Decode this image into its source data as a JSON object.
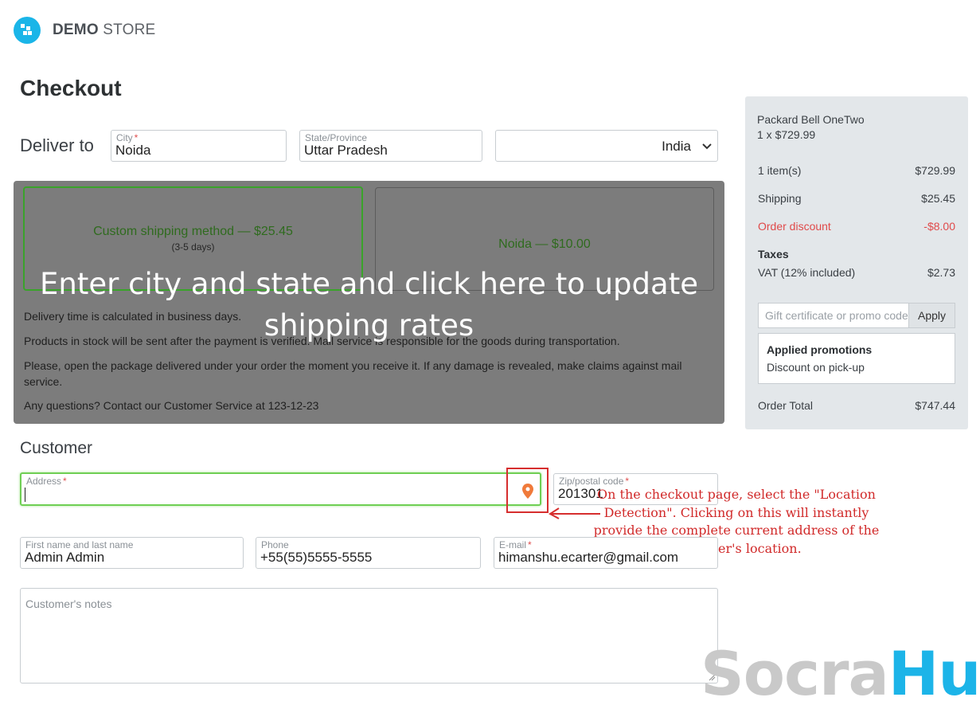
{
  "header": {
    "logo_bold": "DEMO",
    "logo_light": "STORE",
    "logo_icon": "store-logo-icon"
  },
  "page": {
    "title": "Checkout"
  },
  "delivery": {
    "label": "Deliver to",
    "city": {
      "label": "City",
      "required_mark": "*",
      "value": "Noida"
    },
    "state": {
      "label": "State/Province",
      "value": "Uttar Pradesh"
    },
    "country": {
      "value": "India"
    }
  },
  "shipping": {
    "methods": [
      {
        "name": "Custom shipping method — $25.45",
        "sub": "(3-5 days)",
        "selected": true
      },
      {
        "name": "Noida — $10.00",
        "sub": "",
        "selected": false
      }
    ],
    "notes": [
      "Delivery time is calculated in business days.",
      "Products in stock will be sent after the payment is verified. Mail service is responsible for the goods during transportation.",
      "Please, open the package delivered under your order the moment you receive it. If any damage is revealed, make claims against mail service.",
      "Any questions? Contact our Customer Service at 123-12-23"
    ],
    "overlay_message": "Enter city and state and click here to update shipping rates"
  },
  "customer": {
    "title": "Customer",
    "address": {
      "label": "Address",
      "required_mark": "*",
      "value": ""
    },
    "zip": {
      "label": "Zip/postal code",
      "required_mark": "*",
      "value": "201301"
    },
    "name": {
      "label": "First name and last name",
      "value": "Admin Admin"
    },
    "phone": {
      "label": "Phone",
      "value": "+55(55)5555-5555"
    },
    "email": {
      "label": "E-mail",
      "required_mark": "*",
      "value": "himanshu.ecarter@gmail.com"
    },
    "notes_placeholder": "Customer's notes",
    "location_icon": "location-pin-icon"
  },
  "annotation": {
    "text": "On the checkout page, select the \"Location Detection\". Clicking on this will instantly provide the complete current address of the customer's location."
  },
  "summary": {
    "product_name": "Packard Bell OneTwo",
    "product_qty": "1 x $729.99",
    "items_label": "1 item(s)",
    "items_value": "$729.99",
    "shipping_label": "Shipping",
    "shipping_value": "$25.45",
    "discount_label": "Order discount",
    "discount_value": "-$8.00",
    "taxes_label": "Taxes",
    "vat_label": "VAT (12% included)",
    "vat_value": "$2.73",
    "promo_placeholder": "Gift certificate or promo code",
    "apply_label": "Apply",
    "promotions_title": "Applied promotions",
    "promotion_item": "Discount on pick-up",
    "total_label": "Order Total",
    "total_value": "$747.44"
  },
  "watermark": {
    "part1": "Socra",
    "part2": "Hub"
  },
  "colors": {
    "accent": "#1ab5e8",
    "selected_border": "#3aa32a",
    "annotation": "#d12a2a",
    "discount": "#e04a4a"
  }
}
